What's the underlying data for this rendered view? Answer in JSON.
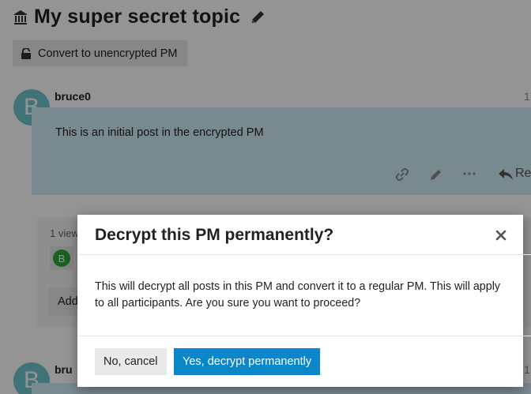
{
  "topic": {
    "title": "My super secret topic",
    "lock_icon": "encrypted-lock-icon",
    "edit_icon": "pencil-icon"
  },
  "toolbar": {
    "convert_label": "Convert to unencrypted PM",
    "convert_icon": "unlock-icon"
  },
  "posts": [
    {
      "avatar_letter": "B",
      "username": "bruce0",
      "date_fragment": "1",
      "body": "This is an initial post in the encrypted PM",
      "actions": [
        "link-icon",
        "pencil-icon",
        "more-icon",
        "reply-icon"
      ],
      "reply_fragment": "Re"
    },
    {
      "avatar_letter": "B",
      "username_fragment": "bru",
      "date_fragment": "1"
    }
  ],
  "summary": {
    "views_fragment": "1 view",
    "participant_letter": "B",
    "add_fragment": "Add"
  },
  "modal": {
    "title": "Decrypt this PM permanently?",
    "body": "This will decrypt all posts in this PM and convert it to a regular PM. This will apply to all participants. Are you sure you want to proceed?",
    "cancel_label": "No, cancel",
    "confirm_label": "Yes, decrypt permanently",
    "close_icon": "close-icon"
  },
  "colors": {
    "accent": "#0a87c9",
    "post_highlight": "#d1ecf8",
    "avatar": "#6fc7cf",
    "participant_avatar": "#2aa83a"
  }
}
